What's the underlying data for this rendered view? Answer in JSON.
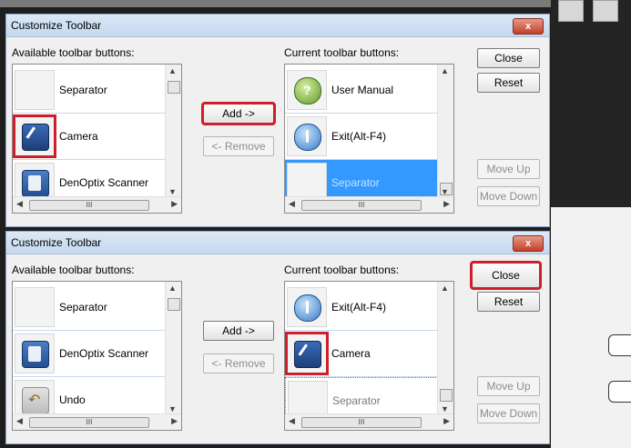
{
  "colors": {
    "selection": "#3399ff",
    "highlight_box": "#cc1f2b",
    "titlebar": "#c5d8ef"
  },
  "dialogs": [
    {
      "title": "Customize Toolbar",
      "close_glyph": "x",
      "available_label": "Available toolbar buttons:",
      "current_label": "Current toolbar buttons:",
      "available_items": [
        {
          "label": "Separator",
          "icon": "blank"
        },
        {
          "label": "Camera",
          "icon": "camera-icon"
        },
        {
          "label": "DenOptix Scanner",
          "icon": "scanner-icon"
        }
      ],
      "current_items": [
        {
          "label": "User Manual",
          "icon": "help-icon"
        },
        {
          "label": "Exit(Alt-F4)",
          "icon": "exit-icon"
        },
        {
          "label": "Separator",
          "icon": "blank",
          "state": "selected"
        }
      ],
      "buttons": {
        "add": "Add ->",
        "remove": "<- Remove",
        "close": "Close",
        "reset": "Reset",
        "move_up": "Move Up",
        "move_down": "Move Down"
      },
      "highlighted": [
        "add-button",
        "available-item-camera"
      ]
    },
    {
      "title": "Customize Toolbar",
      "close_glyph": "x",
      "available_label": "Available toolbar buttons:",
      "current_label": "Current toolbar buttons:",
      "available_items": [
        {
          "label": "Separator",
          "icon": "blank"
        },
        {
          "label": "DenOptix Scanner",
          "icon": "scanner-icon"
        },
        {
          "label": "Undo",
          "icon": "undo-icon"
        }
      ],
      "current_items": [
        {
          "label": "Exit(Alt-F4)",
          "icon": "exit-icon"
        },
        {
          "label": "Camera",
          "icon": "camera-icon"
        },
        {
          "label": "Separator",
          "icon": "blank",
          "state": "dim"
        }
      ],
      "buttons": {
        "add": "Add ->",
        "remove": "<- Remove",
        "close": "Close",
        "reset": "Reset",
        "move_up": "Move Up",
        "move_down": "Move Down"
      },
      "highlighted": [
        "close-button",
        "current-item-camera"
      ]
    }
  ],
  "scrollbar_glyph": "III"
}
